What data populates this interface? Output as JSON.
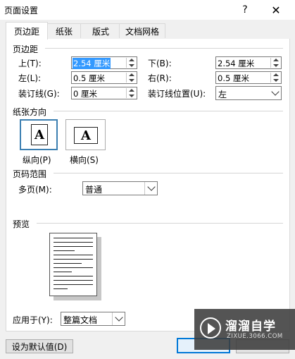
{
  "window": {
    "title": "页面设置",
    "help_glyph": "?",
    "close_glyph": "✕"
  },
  "tabs": [
    {
      "label": "页边距",
      "active": true
    },
    {
      "label": "纸张"
    },
    {
      "label": "版式"
    },
    {
      "label": "文档网格"
    }
  ],
  "margins": {
    "section_label": "页边距",
    "top": {
      "label": "上(T):",
      "value": "2.54 厘米"
    },
    "bottom": {
      "label": "下(B):",
      "value": "2.54 厘米"
    },
    "left": {
      "label": "左(L):",
      "value": "0.5 厘米"
    },
    "right": {
      "label": "右(R):",
      "value": "0.5 厘米"
    },
    "gutter": {
      "label": "装订线(G):",
      "value": "0 厘米"
    },
    "gutter_position": {
      "label": "装订线位置(U):",
      "value": "左"
    }
  },
  "orientation": {
    "section_label": "纸张方向",
    "glyph": "A",
    "portrait_label": "纵向(P)",
    "landscape_label": "横向(S)",
    "selected": "portrait"
  },
  "pages": {
    "section_label": "页码范围",
    "multiple_label": "多页(M):",
    "multiple_value": "普通"
  },
  "preview": {
    "section_label": "预览"
  },
  "apply": {
    "label": "应用于(Y):",
    "value": "整篇文档"
  },
  "footer": {
    "default_button": "设为默认值(D)"
  },
  "watermark": {
    "brand": "溜溜自学",
    "url": "ZIXUE.3066.COM"
  },
  "colors": {
    "selection": "#3399ff",
    "accent_border": "#3c7fb1",
    "ok_border": "#0078d7"
  }
}
